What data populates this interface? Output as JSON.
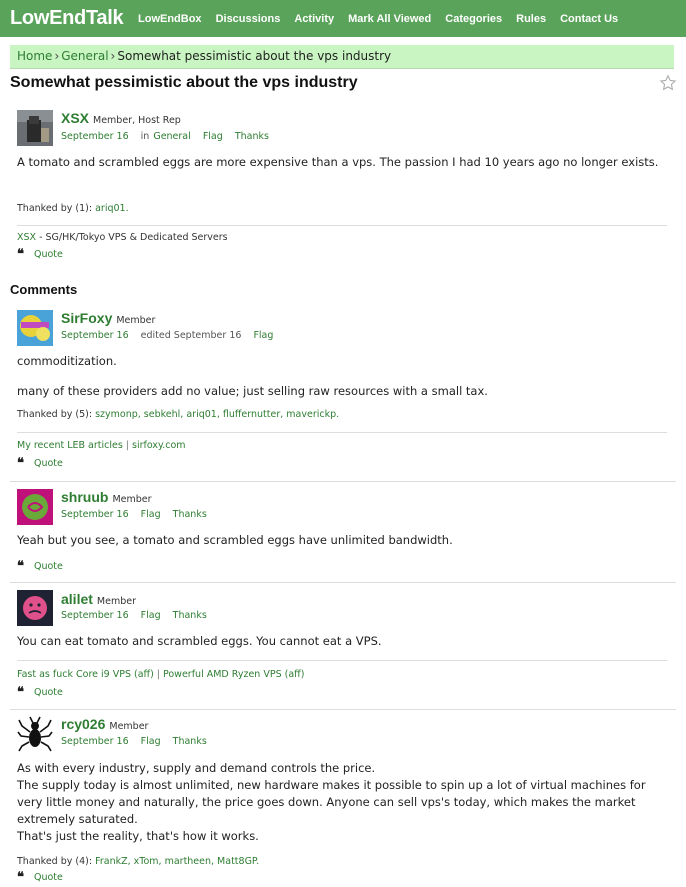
{
  "header": {
    "logo": "LowEndTalk",
    "nav": [
      "LowEndBox",
      "Discussions",
      "Activity",
      "Mark All Viewed",
      "Categories",
      "Rules",
      "Contact Us"
    ]
  },
  "breadcrumb": {
    "home": "Home",
    "category": "General",
    "current": "Somewhat pessimistic about the vps industry"
  },
  "discussion": {
    "title": "Somewhat pessimistic about the vps industry",
    "author": "XSX",
    "role": "Member, Host Rep",
    "date": "September 16",
    "in_label": "in",
    "category": "General",
    "flag": "Flag",
    "thanks": "Thanks",
    "body": "A tomato and scrambled eggs are more expensive than a vps. The passion I had 10 years ago no longer exists.",
    "thanked_label": "Thanked by (1):",
    "thanked_names": "ariq01.",
    "sig_link": "XSX",
    "sig_text": "- SG/HK/Tokyo VPS & Dedicated Servers",
    "quote": "Quote"
  },
  "comments_heading": "Comments",
  "comments": [
    {
      "author": "SirFoxy",
      "role": "Member",
      "date": "September 16",
      "edited": "edited September 16",
      "flag": "Flag",
      "body1": "commoditization.",
      "body2": "many of these providers add no value; just selling raw resources with a small tax.",
      "thanked_label": "Thanked by (5):",
      "thanked_names": "szymonp, sebkehl, ariq01, fluffernutter, maverickp.",
      "sig1": "My recent LEB articles",
      "sig2": "sirfoxy.com",
      "quote": "Quote"
    },
    {
      "author": "shruub",
      "role": "Member",
      "date": "September 16",
      "flag": "Flag",
      "thanks": "Thanks",
      "body": "Yeah but you see, a tomato and scrambled eggs have unlimited bandwidth.",
      "quote": "Quote"
    },
    {
      "author": "alilet",
      "role": "Member",
      "date": "September 16",
      "flag": "Flag",
      "thanks": "Thanks",
      "body": "You can eat tomato and scrambled eggs. You cannot eat a VPS.",
      "sig1": "Fast as fuck Core i9 VPS (aff)",
      "sig2": "Powerful AMD Ryzen VPS (aff)",
      "quote": "Quote"
    },
    {
      "author": "rcy026",
      "role": "Member",
      "date": "September 16",
      "flag": "Flag",
      "thanks": "Thanks",
      "body1": "As with every industry, supply and demand controls the price.",
      "body2": "The supply today is almost unlimited, new hardware makes it possible to spin up a lot of virtual machines for very little money and naturally, the price goes down. Anyone can sell vps's today, which makes the market extremely saturated.",
      "body3": "That's just the reality, that's how it works.",
      "thanked_label": "Thanked by (4):",
      "thanked_names": "FrankZ, xTom, martheen, Matt8GP.",
      "quote": "Quote"
    }
  ],
  "colors": {
    "header": "#5aa35a",
    "breadcrumb": "#c9f5c2",
    "link": "#2e7d32"
  },
  "icons": [
    "star-icon",
    "quote-icon",
    "avatar-image"
  ]
}
